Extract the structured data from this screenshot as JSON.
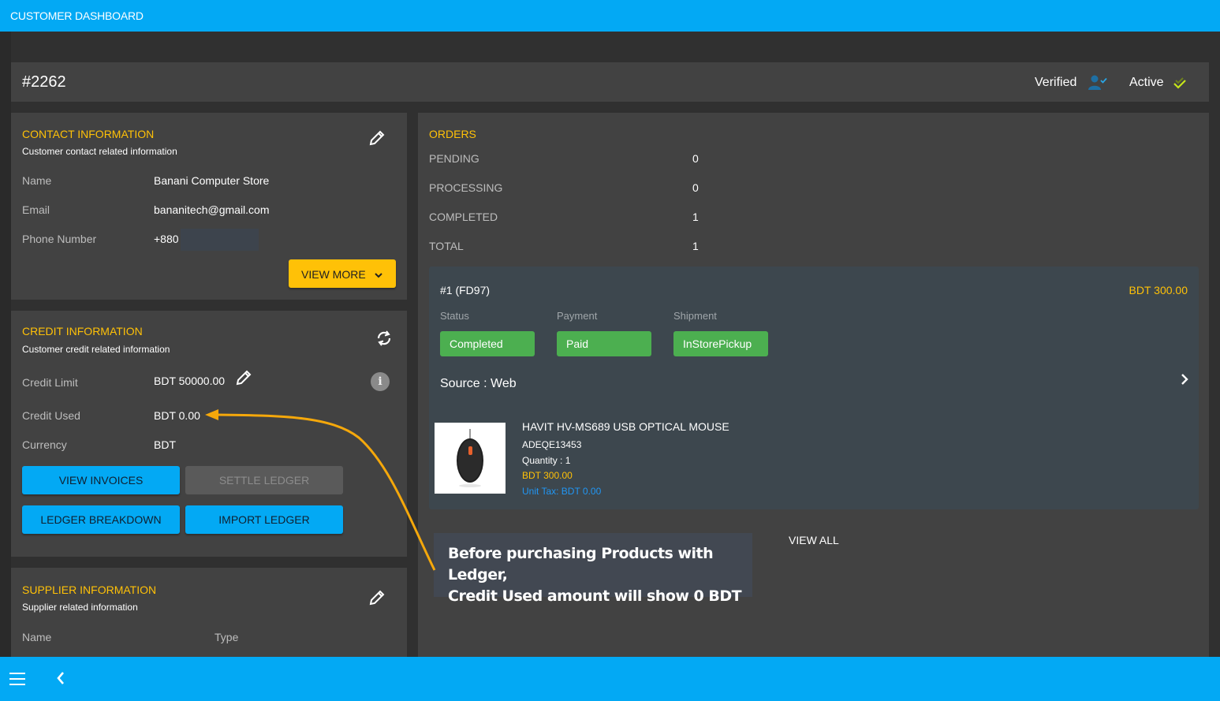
{
  "app": {
    "title": "CUSTOMER DASHBOARD"
  },
  "customer": {
    "id": "#2262",
    "verified_label": "Verified",
    "active_label": "Active"
  },
  "contact": {
    "title": "CONTACT INFORMATION",
    "subtitle": "Customer contact related information",
    "rows": [
      {
        "label": "Name",
        "value": "Banani Computer Store"
      },
      {
        "label": "Email",
        "value": "bananitech@gmail.com"
      },
      {
        "label": "Phone Number",
        "value": "+880"
      }
    ],
    "view_more_label": "VIEW MORE"
  },
  "credit": {
    "title": "CREDIT INFORMATION",
    "subtitle": "Customer credit related information",
    "rows": [
      {
        "label": "Credit Limit",
        "value": "BDT 50000.00"
      },
      {
        "label": "Credit Used",
        "value": "BDT 0.00"
      },
      {
        "label": "Currency",
        "value": "BDT"
      }
    ],
    "buttons": {
      "view_invoices": "VIEW INVOICES",
      "settle_ledger": "SETTLE LEDGER",
      "ledger_breakdown": "LEDGER BREAKDOWN",
      "import_ledger": "IMPORT LEDGER"
    }
  },
  "supplier": {
    "title": "SUPPLIER INFORMATION",
    "subtitle": "Supplier related information",
    "col_name": "Name",
    "col_type": "Type"
  },
  "orders": {
    "title": "ORDERS",
    "stats": [
      {
        "label": "PENDING",
        "value": "0"
      },
      {
        "label": "PROCESSING",
        "value": "0"
      },
      {
        "label": "COMPLETED",
        "value": "1"
      },
      {
        "label": "TOTAL",
        "value": "1"
      }
    ],
    "item": {
      "id": "#1 (FD97)",
      "amount": "BDT 300.00",
      "status_label": "Status",
      "status_value": "Completed",
      "payment_label": "Payment",
      "payment_value": "Paid",
      "shipment_label": "Shipment",
      "shipment_value": "InStorePickup",
      "source": "Source : Web",
      "product": {
        "name": "HAVIT HV-MS689 USB OPTICAL MOUSE",
        "sku": "ADEQE13453",
        "quantity": "Quantity : 1",
        "price": "BDT 300.00",
        "unit_tax": "Unit Tax: BDT 0.00"
      }
    },
    "view_all_label": "VIEW ALL"
  },
  "annotation": {
    "text_line1": "Before purchasing Products with Ledger,",
    "text_line2": "Credit Used amount will show 0 BDT",
    "color": "#f5a80b"
  },
  "colors": {
    "primary": "#03a9f4",
    "accent": "#ffc107",
    "success": "#4caf50",
    "card": "#424242",
    "background": "#303030"
  }
}
